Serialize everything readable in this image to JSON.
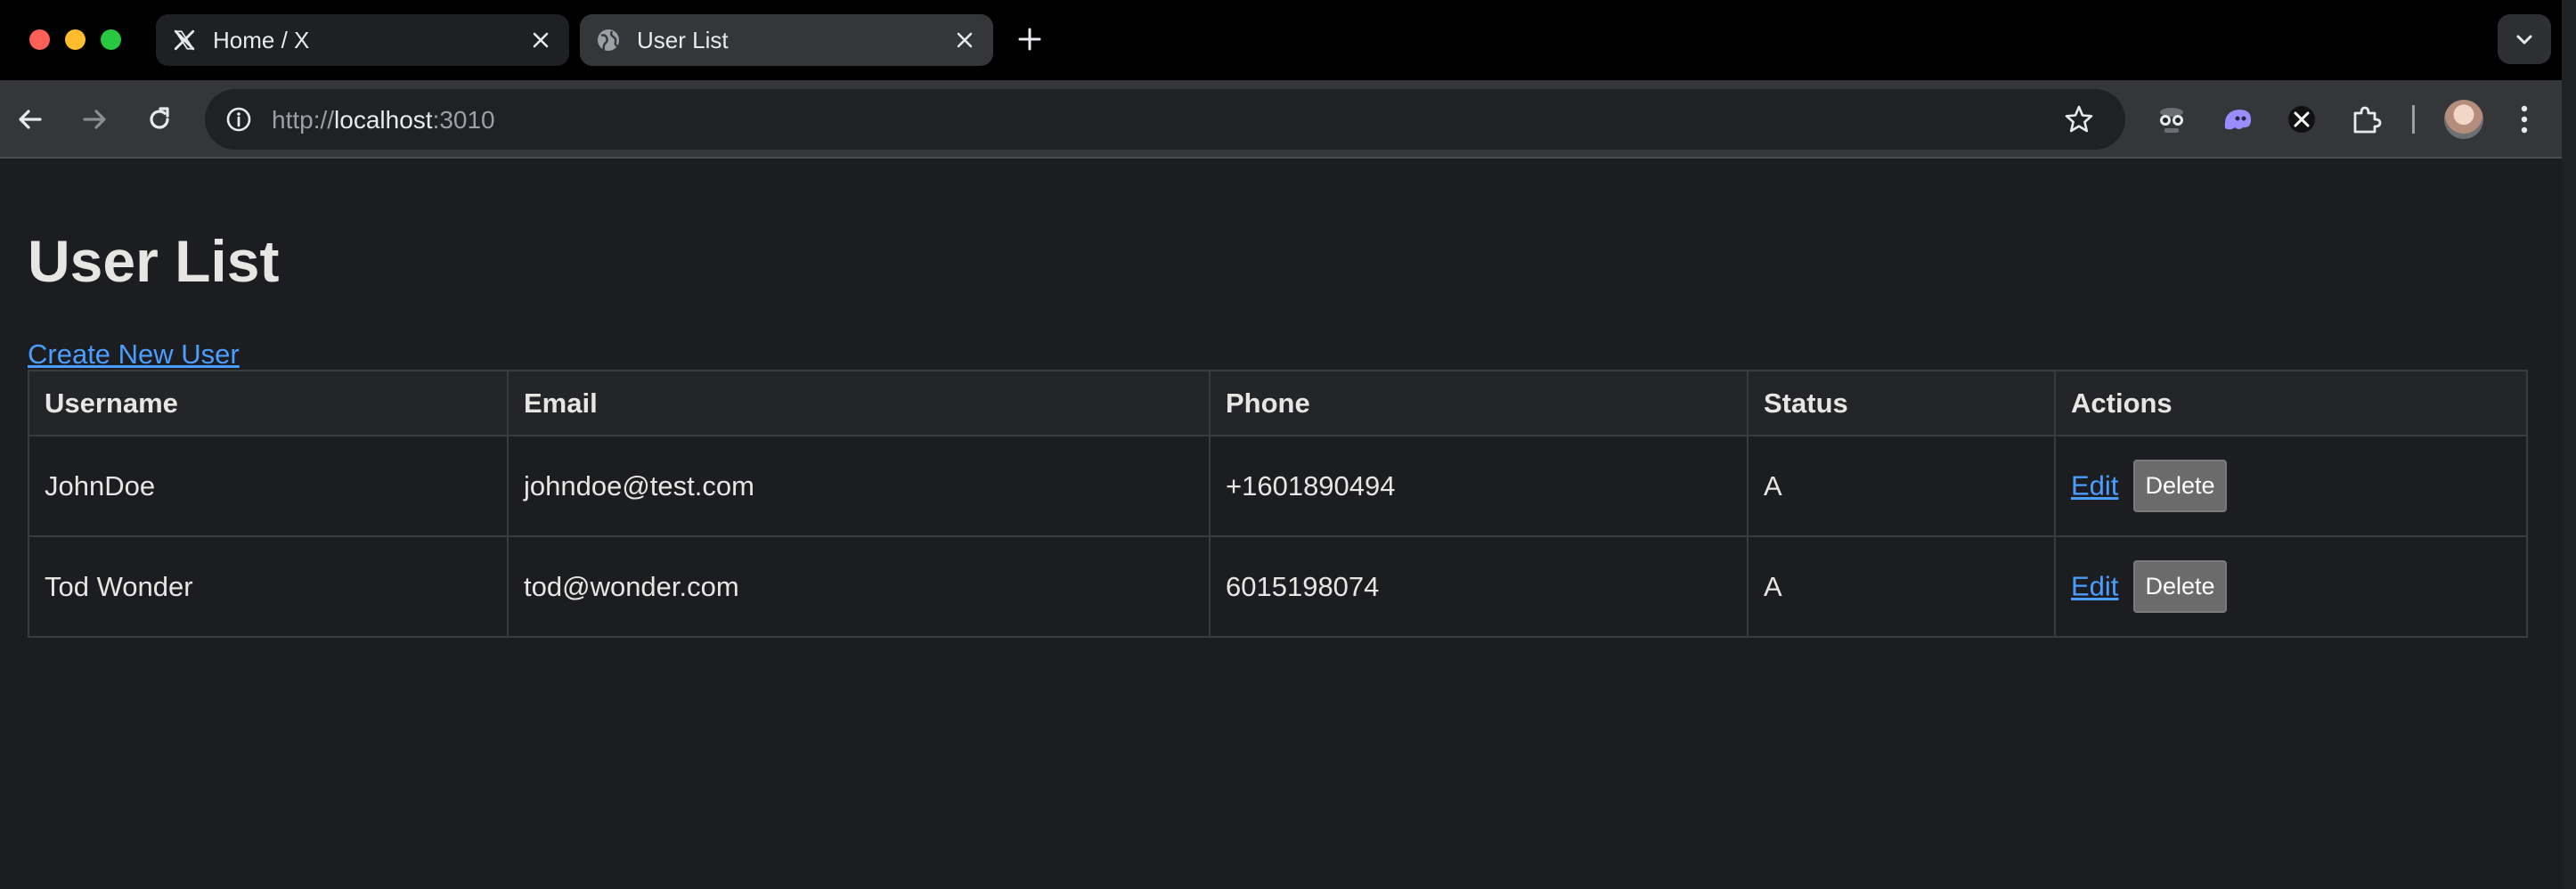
{
  "browser": {
    "tabs": [
      {
        "title": "Home / X",
        "favicon": "x-logo-icon",
        "active": false
      },
      {
        "title": "User List",
        "favicon": "globe-icon",
        "active": true
      }
    ],
    "url": {
      "scheme": "http://",
      "host": "localhost",
      "port": ":3010"
    },
    "colors": {
      "traffic_red": "#fe5f57",
      "traffic_yellow": "#febc2e",
      "traffic_green": "#28c840"
    }
  },
  "page": {
    "heading": "User List",
    "create_link": "Create New User",
    "columns": [
      "Username",
      "Email",
      "Phone",
      "Status",
      "Actions"
    ],
    "rows": [
      {
        "username": "JohnDoe",
        "email": "johndoe@test.com",
        "phone": "+1601890494",
        "status": "A",
        "edit": "Edit",
        "delete": "Delete"
      },
      {
        "username": "Tod Wonder",
        "email": "tod@wonder.com",
        "phone": "6015198074",
        "status": "A",
        "edit": "Edit",
        "delete": "Delete"
      }
    ],
    "colors": {
      "link": "#4a9eff",
      "background": "#1c1d20",
      "delete_button": "#6b6b6b"
    }
  }
}
